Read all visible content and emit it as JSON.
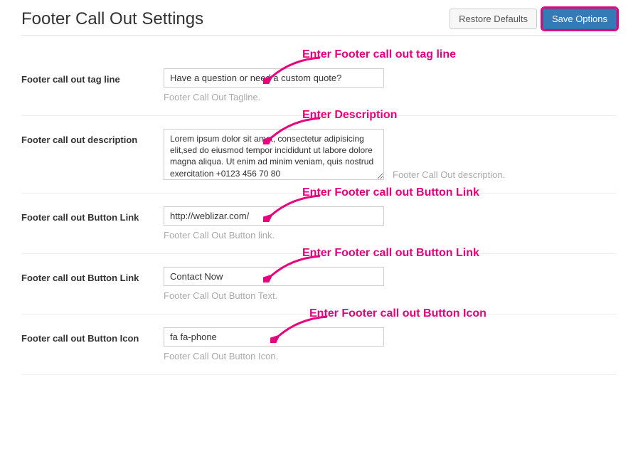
{
  "header": {
    "title": "Footer Call Out Settings",
    "restore_label": "Restore Defaults",
    "save_label": "Save Options"
  },
  "annotations": {
    "tagline": "Enter Footer call out tag line",
    "description": "Enter Description",
    "button_link": "Enter Footer call out Button Link",
    "button_text": "Enter Footer call out Button Link",
    "button_icon": "Enter Footer call out Button Icon"
  },
  "fields": {
    "tagline": {
      "label": "Footer call out tag line",
      "value": "Have a question or need a custom quote?",
      "hint": "Footer Call Out Tagline."
    },
    "description": {
      "label": "Footer call out description",
      "value": "Lorem ipsum dolor sit amet, consectetur adipisicing elit,sed do eiusmod tempor incididunt ut labore dolore magna aliqua. Ut enim ad minim veniam, quis nostrud exercitation +0123 456 70 80",
      "hint": "Footer Call Out description."
    },
    "button_link": {
      "label": "Footer call out Button Link",
      "value": "http://weblizar.com/",
      "hint": "Footer Call Out Button link."
    },
    "button_text": {
      "label": "Footer call out Button Link",
      "value": "Contact Now",
      "hint": "Footer Call Out Button Text."
    },
    "button_icon": {
      "label": "Footer call out Button Icon",
      "value": "fa fa-phone",
      "hint": "Footer Call Out Button Icon."
    }
  }
}
